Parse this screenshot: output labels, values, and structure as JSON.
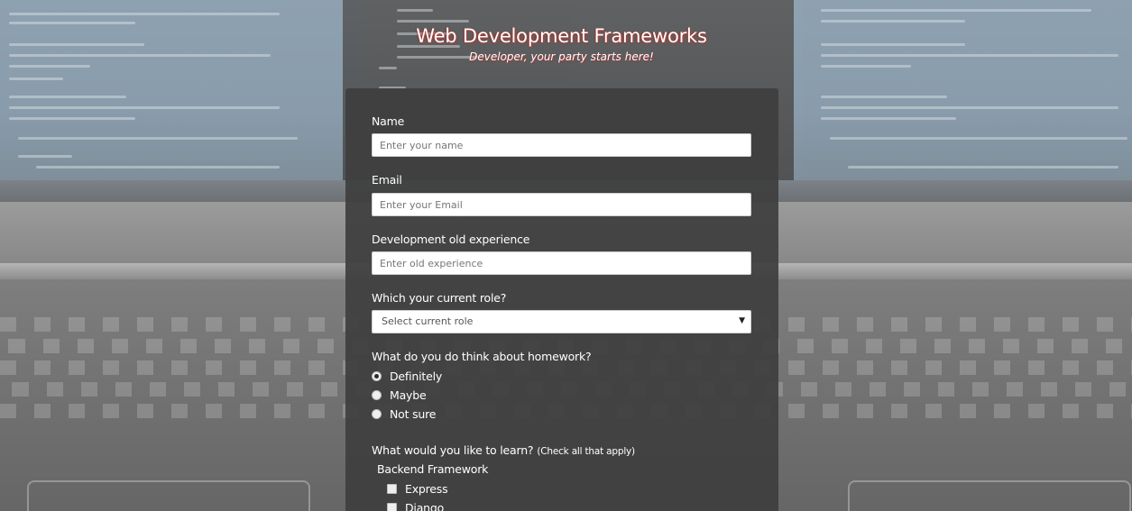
{
  "header": {
    "title": "Web Development Frameworks",
    "subtitle": "Developer, your party starts here!"
  },
  "form": {
    "name": {
      "label": "Name",
      "placeholder": "Enter your name",
      "value": ""
    },
    "email": {
      "label": "Email",
      "placeholder": "Enter your Email",
      "value": ""
    },
    "experience": {
      "label": "Development old experience",
      "placeholder": "Enter old experience",
      "value": ""
    },
    "role": {
      "label": "Which your current role?",
      "selected": "Select current role"
    },
    "homework": {
      "label": "What do you do think about homework?",
      "options": [
        {
          "label": "Definitely",
          "checked": true
        },
        {
          "label": "Maybe",
          "checked": false
        },
        {
          "label": "Not sure",
          "checked": false
        }
      ]
    },
    "learn": {
      "label": "What would you like to learn?",
      "hint": "(Check all that apply)",
      "group_label": "Backend Framework",
      "options": [
        {
          "label": "Express",
          "checked": false
        },
        {
          "label": "Django",
          "checked": false
        }
      ]
    }
  },
  "colors": {
    "card_bg": "#3e3e3e",
    "title_shadow": "#c0392b",
    "text": "#ffffff"
  }
}
